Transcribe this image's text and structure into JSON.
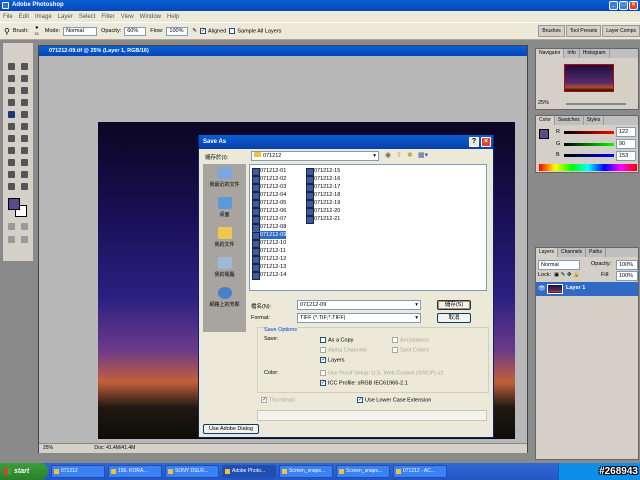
{
  "app": {
    "title": "Adobe Photoshop",
    "menu": [
      "File",
      "Edit",
      "Image",
      "Layer",
      "Select",
      "Filter",
      "View",
      "Window",
      "Help"
    ]
  },
  "options_bar": {
    "brush_label": "Brush:",
    "brush_size": "21",
    "mode_label": "Mode:",
    "mode_value": "Normal",
    "opacity_label": "Opacity:",
    "opacity_value": "60%",
    "flow_label": "Flow:",
    "flow_value": "100%",
    "aligned_label": "Aligned",
    "sample_all_label": "Sample All Layers",
    "well_tabs": [
      "Brushes",
      "Tool Presets",
      "Layer Comps"
    ]
  },
  "document": {
    "title": "071212-09.tif @ 25% (Layer 1, RGB/16)",
    "zoom": "25%",
    "doc_size": "Doc: 41.4M/41.4M"
  },
  "navigator": {
    "tabs": [
      "Navigator",
      "Info",
      "Histogram"
    ],
    "zoom": "25%"
  },
  "color_panel": {
    "tabs": [
      "Color",
      "Swatches",
      "Styles"
    ],
    "r": "122",
    "g": "90",
    "b": "153",
    "fg_color": "#5a4a8a"
  },
  "layers": {
    "tabs": [
      "Layers",
      "Channels",
      "Paths"
    ],
    "blend": "Normal",
    "opacity_label": "Opacity:",
    "opacity": "100%",
    "lock_label": "Lock:",
    "fill_label": "Fill:",
    "fill": "100%",
    "layer_name": "Layer 1"
  },
  "dialog": {
    "title": "Save As",
    "save_in_label": "儲存於(I):",
    "save_in_value": "071212",
    "places": [
      "我最近的文件",
      "桌面",
      "我的文件",
      "我的電腦",
      "網路上的芳鄰"
    ],
    "files_col1": [
      "071212-01",
      "071212-02",
      "071212-03",
      "071212-04",
      "071212-05",
      "071212-06",
      "071212-07",
      "071212-08",
      "071212-09",
      "071212-10",
      "071212-11",
      "071212-12",
      "071212-13",
      "071212-14"
    ],
    "files_col2": [
      "071212-15",
      "071212-16",
      "071212-17",
      "071212-18",
      "071212-19",
      "071212-20",
      "071212-21"
    ],
    "selected_file": "071212-09",
    "filename_label": "檔名(N):",
    "filename_value": "071212-09",
    "format_label": "Format:",
    "format_value": "TIFF (*.TIF;*.TIFF)",
    "save_button": "儲存(S)",
    "cancel_button": "取消",
    "save_options_title": "Save Options",
    "save_label": "Save:",
    "as_copy": "As a Copy",
    "alpha_channels": "Alpha Channels",
    "layers": "Layers",
    "annotations": "Annotations",
    "spot_colors": "Spot Colors",
    "color_label": "Color:",
    "proof_setup": "Use Proof Setup:  U.S. Web Coated (SWOP) v2",
    "icc_profile": "ICC Profile:  sRGB IEC61966-2.1",
    "thumbnail": "Thumbnail",
    "lower_case": "Use Lower Case Extension",
    "adobe_dialog": "Use Adobe Dialog"
  },
  "taskbar": {
    "start": "start",
    "tasks": [
      "071212",
      "156. KORA...",
      "SONY DSLR...",
      "Adobe Photo...",
      "Screen_snaps...",
      "Screen_snaps...",
      "071212 - AC..."
    ],
    "active_index": 3,
    "watermark": "#268943"
  }
}
